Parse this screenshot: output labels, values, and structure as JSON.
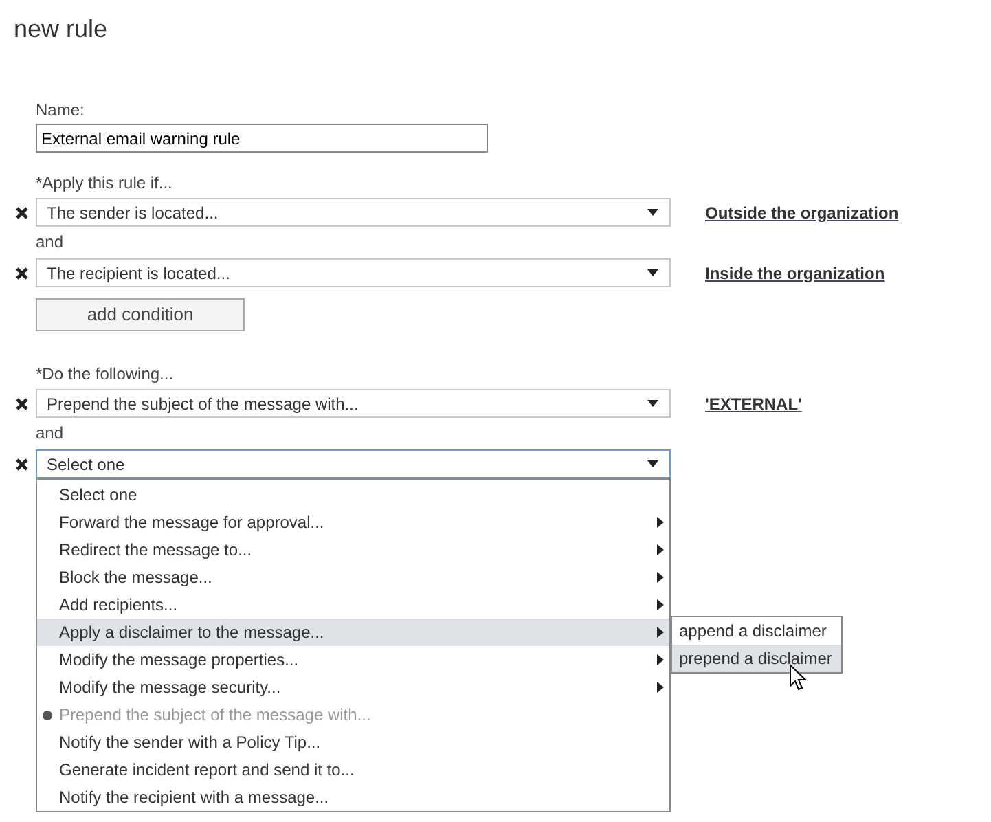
{
  "title": "new rule",
  "name_field": {
    "label": "Name:",
    "value": "External email warning rule"
  },
  "conditions": {
    "label": "*Apply this rule if...",
    "joiner": "and",
    "rows": [
      {
        "value": "The sender is located...",
        "link": "Outside the organization"
      },
      {
        "value": "The recipient is located...",
        "link": "Inside the organization"
      }
    ],
    "add_button": "add condition"
  },
  "actions": {
    "label": "*Do the following...",
    "joiner": "and",
    "rows": [
      {
        "value": "Prepend the subject of the message with...",
        "link": "'EXTERNAL'",
        "focused": false
      },
      {
        "value": "Select one",
        "focused": true
      }
    ]
  },
  "menu": [
    {
      "label": "Select one",
      "submenu": false,
      "disabled": false,
      "highlighted": false
    },
    {
      "label": "Forward the message for approval...",
      "submenu": true,
      "disabled": false,
      "highlighted": false
    },
    {
      "label": "Redirect the message to...",
      "submenu": true,
      "disabled": false,
      "highlighted": false
    },
    {
      "label": "Block the message...",
      "submenu": true,
      "disabled": false,
      "highlighted": false
    },
    {
      "label": "Add recipients...",
      "submenu": true,
      "disabled": false,
      "highlighted": false
    },
    {
      "label": "Apply a disclaimer to the message...",
      "submenu": true,
      "disabled": false,
      "highlighted": true
    },
    {
      "label": "Modify the message properties...",
      "submenu": true,
      "disabled": false,
      "highlighted": false
    },
    {
      "label": "Modify the message security...",
      "submenu": true,
      "disabled": false,
      "highlighted": false
    },
    {
      "label": "Prepend the subject of the message with...",
      "submenu": false,
      "disabled": true,
      "highlighted": false
    },
    {
      "label": "Notify the sender with a Policy Tip...",
      "submenu": false,
      "disabled": false,
      "highlighted": false
    },
    {
      "label": "Generate incident report and send it to...",
      "submenu": false,
      "disabled": false,
      "highlighted": false
    },
    {
      "label": "Notify the recipient with a message...",
      "submenu": false,
      "disabled": false,
      "highlighted": false
    }
  ],
  "submenu": [
    {
      "label": "append a disclaimer",
      "highlighted": false
    },
    {
      "label": "prepend a disclaimer",
      "highlighted": true
    }
  ]
}
